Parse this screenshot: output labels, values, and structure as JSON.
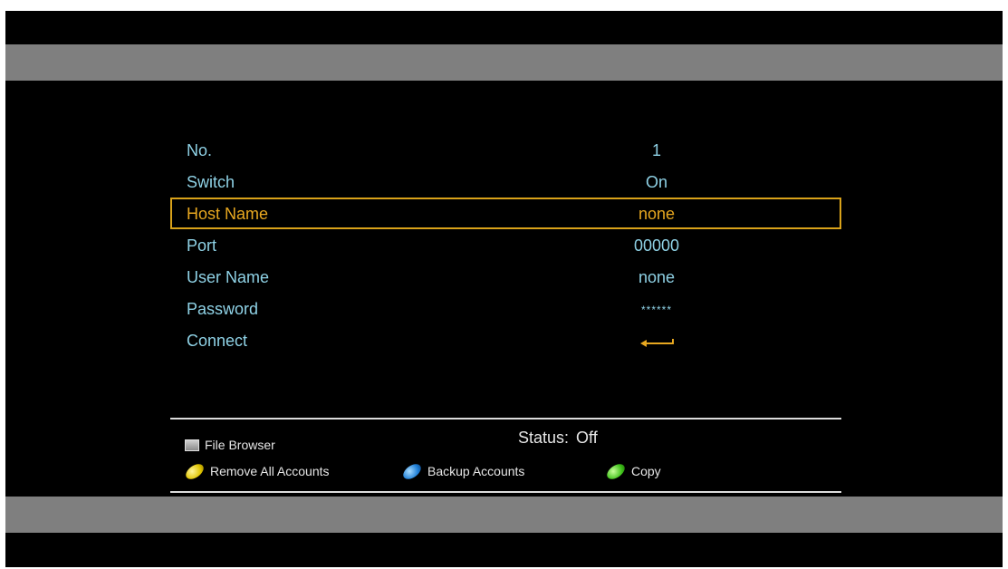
{
  "menu": {
    "rows": [
      {
        "label": "No.",
        "value": "1"
      },
      {
        "label": "Switch",
        "value": "On"
      },
      {
        "label": "Host Name",
        "value": "none"
      },
      {
        "label": "Port",
        "value": "00000"
      },
      {
        "label": "User Name",
        "value": "none"
      },
      {
        "label": "Password",
        "value": "******"
      },
      {
        "label": "Connect",
        "value_icon": "enter-arrow-icon"
      }
    ],
    "selected_index": 2
  },
  "status": {
    "label": "Status:",
    "value": "Off"
  },
  "legend": {
    "file_browser": {
      "label": "File Browser",
      "key": "grey-key-icon"
    },
    "remove_all": {
      "label": "Remove All Accounts",
      "key": "yellow-key-icon"
    },
    "backup": {
      "label": "Backup Accounts",
      "key": "blue-key-icon"
    },
    "copy": {
      "label": "Copy",
      "key": "green-key-icon"
    }
  },
  "colors": {
    "text": "#8fd2e6",
    "highlight": "#e8a820",
    "band": "#7f7f7f",
    "background": "#000000"
  }
}
